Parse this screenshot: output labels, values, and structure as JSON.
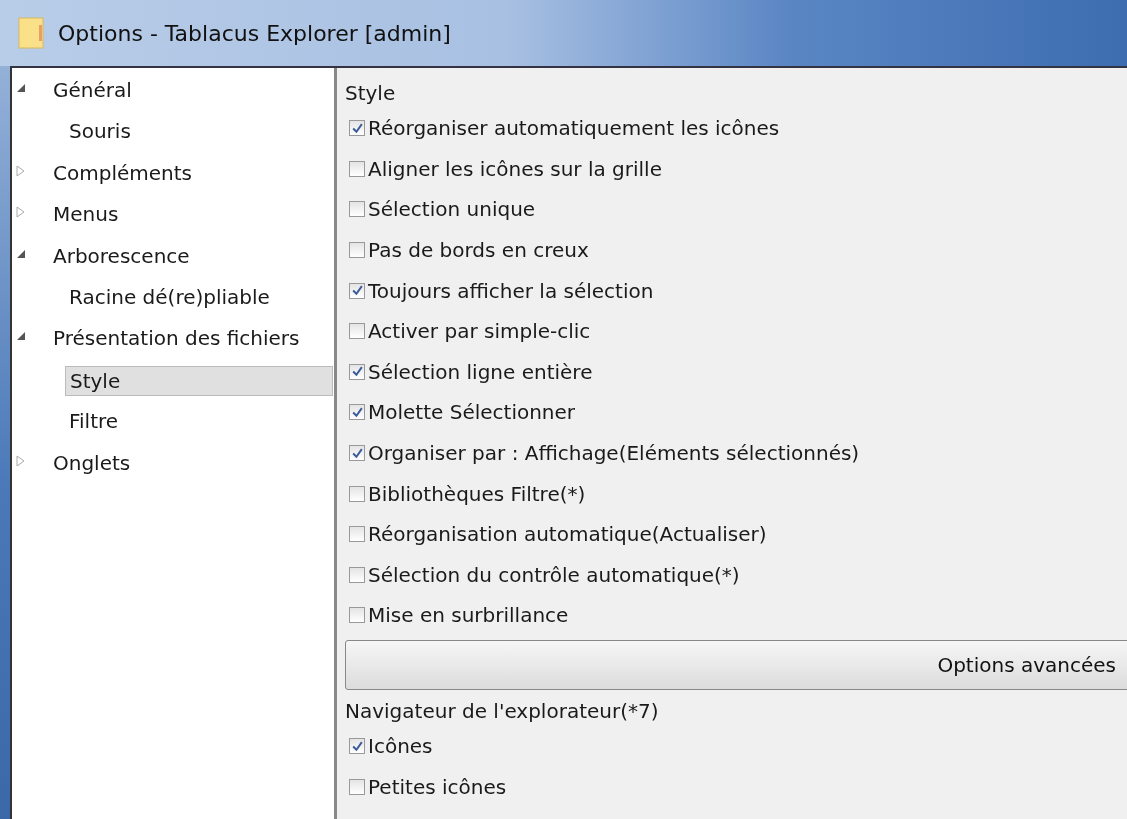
{
  "window": {
    "title": "Options - Tablacus Explorer [admin]"
  },
  "tree": [
    {
      "label": "Général",
      "expanded": true,
      "selected": false,
      "children": [
        {
          "label": "Souris",
          "selected": false
        }
      ]
    },
    {
      "label": "Compléments",
      "expanded": false,
      "selected": false
    },
    {
      "label": "Menus",
      "expanded": false,
      "selected": false
    },
    {
      "label": "Arborescence",
      "expanded": true,
      "selected": false,
      "children": [
        {
          "label": "Racine dé(re)pliable",
          "selected": false
        }
      ]
    },
    {
      "label": "Présentation des fichiers",
      "expanded": true,
      "selected": false,
      "children": [
        {
          "label": "Style",
          "selected": true
        },
        {
          "label": "Filtre",
          "selected": false
        }
      ]
    },
    {
      "label": "Onglets",
      "expanded": false,
      "selected": false
    }
  ],
  "panel": {
    "heading": "Style",
    "options": [
      {
        "label": "Réorganiser automatiquement les icônes",
        "checked": true
      },
      {
        "label": "Aligner les icônes sur la grille",
        "checked": false
      },
      {
        "label": "Sélection unique",
        "checked": false
      },
      {
        "label": "Pas de bords en creux",
        "checked": false
      },
      {
        "label": "Toujours afficher la sélection",
        "checked": true
      },
      {
        "label": "Activer par simple-clic",
        "checked": false
      },
      {
        "label": "Sélection ligne entière",
        "checked": true
      },
      {
        "label": "Molette Sélectionner",
        "checked": true
      },
      {
        "label": "Organiser par : Affichage(Eléments sélectionnés)",
        "checked": true
      },
      {
        "label": "Bibliothèques Filtre(*)",
        "checked": false
      },
      {
        "label": "Réorganisation automatique(Actualiser)",
        "checked": false
      },
      {
        "label": "Sélection du contrôle automatique(*)",
        "checked": false
      },
      {
        "label": "Mise en surbrillance",
        "checked": false
      }
    ],
    "button": "Options avancées",
    "heading2": "Navigateur de l'explorateur(*7)",
    "options2": [
      {
        "label": "Icônes",
        "checked": true
      },
      {
        "label": "Petites icônes",
        "checked": false
      }
    ]
  }
}
